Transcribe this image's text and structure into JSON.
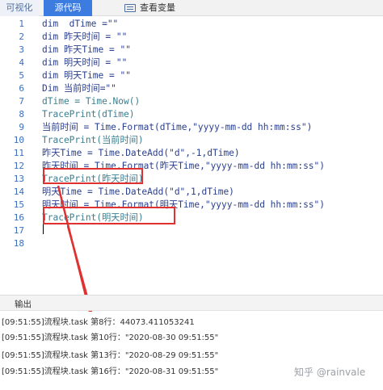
{
  "tabs": {
    "visual": "可视化",
    "source": "源代码",
    "vars": "查看变量"
  },
  "code_lines": [
    {
      "n": "1",
      "text": "dim  dTime =\"\""
    },
    {
      "n": "2",
      "text": "dim 昨天时间 = \"\""
    },
    {
      "n": "3",
      "text": "dim 昨天Time = \"\""
    },
    {
      "n": "4",
      "text": "dim 明天时间 = \"\""
    },
    {
      "n": "5",
      "text": "dim 明天Time = \"\""
    },
    {
      "n": "6",
      "text": "Dim 当前时间=\"\""
    },
    {
      "n": "7",
      "text": "dTime = Time.Now()"
    },
    {
      "n": "8",
      "text": "TracePrint(dTime)"
    },
    {
      "n": "9",
      "text": "当前时间 = Time.Format(dTime,\"yyyy-mm-dd hh:mm:ss\")"
    },
    {
      "n": "10",
      "text": "TracePrint(当前时间)"
    },
    {
      "n": "11",
      "text": "昨天Time = Time.DateAdd(\"d\",-1,dTime)"
    },
    {
      "n": "12",
      "text": "昨天时间 = Time.Format(昨天Time,\"yyyy-mm-dd hh:mm:ss\")"
    },
    {
      "n": "13",
      "text": "TracePrint(昨天时间)"
    },
    {
      "n": "14",
      "text": "明天Time = Time.DateAdd(\"d\",1,dTime)"
    },
    {
      "n": "15",
      "text": "明天时间 = Time.Format(明天Time,\"yyyy-mm-dd hh:mm:ss\")"
    },
    {
      "n": "16",
      "text": "TracePrint(明天时间)"
    },
    {
      "n": "17",
      "text": ""
    },
    {
      "n": "18",
      "text": ""
    }
  ],
  "output": {
    "title": "输出",
    "lines": [
      "[09:51:55]流程块.task 第8行：44073.411053241",
      "[09:51:55]流程块.task 第10行：\"2020-08-30 09:51:55\"",
      "[09:51:55]流程块.task 第13行：\"2020-08-29 09:51:55\"",
      "[09:51:55]流程块.task 第16行：\"2020-08-31 09:51:55\""
    ]
  },
  "watermark": "知乎 @rainvale",
  "colors": {
    "accent": "#3c7be0",
    "highlight": "#e03030",
    "keyword": "#2a3f8f"
  }
}
